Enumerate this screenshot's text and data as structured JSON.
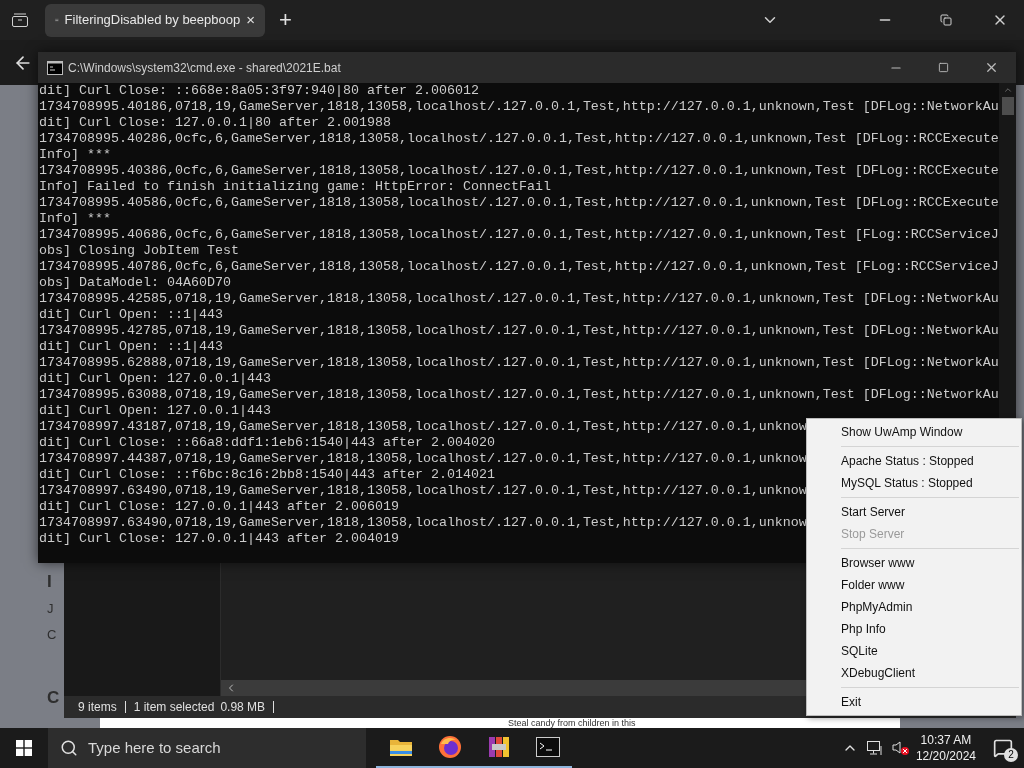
{
  "browser": {
    "tab": {
      "title": "FilteringDisabled by beepboop",
      "close": "×",
      "selected": true
    },
    "new_tab": "+"
  },
  "page": {
    "fragments": [
      {
        "kind": "heading",
        "text": "I"
      },
      {
        "kind": "line",
        "text": "J"
      },
      {
        "kind": "line",
        "text": "C"
      },
      {
        "kind": "heading",
        "text": "C"
      }
    ],
    "footer_text": "Steal candy from children in this"
  },
  "console": {
    "title": "C:\\Windows\\system32\\cmd.exe - shared\\2021E.bat",
    "lines": [
      "dit] Curl Close: ::668e:8a05:3f97:940|80 after 2.006012",
      "1734708995.40186,0718,19,GameServer,1818,13058,localhost/.127.0.0.1,Test,http://127.0.0.1,unknown,Test [DFLog::NetworkAu",
      "dit] Curl Close: 127.0.0.1|80 after 2.001988",
      "1734708995.40286,0cfc,6,GameServer,1818,13058,localhost/.127.0.0.1,Test,http://127.0.0.1,unknown,Test [DFLog::RCCExecute",
      "Info] ***",
      "1734708995.40386,0cfc,6,GameServer,1818,13058,localhost/.127.0.0.1,Test,http://127.0.0.1,unknown,Test [DFLog::RCCExecute",
      "Info] Failed to finish initializing game: HttpError: ConnectFail",
      "1734708995.40586,0cfc,6,GameServer,1818,13058,localhost/.127.0.0.1,Test,http://127.0.0.1,unknown,Test [DFLog::RCCExecute",
      "Info] ***",
      "1734708995.40686,0cfc,6,GameServer,1818,13058,localhost/.127.0.0.1,Test,http://127.0.0.1,unknown,Test [FLog::RCCServiceJ",
      "obs] Closing JobItem Test",
      "1734708995.40786,0cfc,6,GameServer,1818,13058,localhost/.127.0.0.1,Test,http://127.0.0.1,unknown,Test [FLog::RCCServiceJ",
      "obs] DataModel: 04A60D70",
      "1734708995.42585,0718,19,GameServer,1818,13058,localhost/.127.0.0.1,Test,http://127.0.0.1,unknown,Test [DFLog::NetworkAu",
      "dit] Curl Open: ::1|443",
      "1734708995.42785,0718,19,GameServer,1818,13058,localhost/.127.0.0.1,Test,http://127.0.0.1,unknown,Test [DFLog::NetworkAu",
      "dit] Curl Open: ::1|443",
      "1734708995.62888,0718,19,GameServer,1818,13058,localhost/.127.0.0.1,Test,http://127.0.0.1,unknown,Test [DFLog::NetworkAu",
      "dit] Curl Open: 127.0.0.1|443",
      "1734708995.63088,0718,19,GameServer,1818,13058,localhost/.127.0.0.1,Test,http://127.0.0.1,unknown,Test [DFLog::NetworkAu",
      "dit] Curl Open: 127.0.0.1|443",
      "1734708997.43187,0718,19,GameServer,1818,13058,localhost/.127.0.0.1,Test,http://127.0.0.1,unknow",
      "dit] Curl Close: ::66a8:ddf1:1eb6:1540|443 after 2.004020",
      "1734708997.44387,0718,19,GameServer,1818,13058,localhost/.127.0.0.1,Test,http://127.0.0.1,unknow",
      "dit] Curl Close: ::f6bc:8c16:2bb8:1540|443 after 2.014021",
      "1734708997.63490,0718,19,GameServer,1818,13058,localhost/.127.0.0.1,Test,http://127.0.0.1,unknow",
      "dit] Curl Close: 127.0.0.1|443 after 2.006019",
      "1734708997.63490,0718,19,GameServer,1818,13058,localhost/.127.0.0.1,Test,http://127.0.0.1,unknow",
      "dit] Curl Close: 127.0.0.1|443 after 2.004019"
    ]
  },
  "explorer": {
    "status": {
      "items": "9 items",
      "selected": "1 item selected",
      "size": "0.98 MB"
    }
  },
  "tray_menu": {
    "items": [
      {
        "kind": "item",
        "label": "Show UwAmp Window",
        "disabled": false
      },
      {
        "kind": "separator"
      },
      {
        "kind": "item",
        "label": "Apache Status : Stopped",
        "disabled": false
      },
      {
        "kind": "item",
        "label": "MySQL Status : Stopped",
        "disabled": false
      },
      {
        "kind": "separator"
      },
      {
        "kind": "item",
        "label": "Start Server",
        "disabled": false
      },
      {
        "kind": "item",
        "label": "Stop Server",
        "disabled": true
      },
      {
        "kind": "separator"
      },
      {
        "kind": "item",
        "label": "Browser www",
        "disabled": false
      },
      {
        "kind": "item",
        "label": "Folder www",
        "disabled": false
      },
      {
        "kind": "item",
        "label": "PhpMyAdmin",
        "disabled": false
      },
      {
        "kind": "item",
        "label": "Php Info",
        "disabled": false
      },
      {
        "kind": "item",
        "label": "SQLite",
        "disabled": false
      },
      {
        "kind": "item",
        "label": "XDebugClient",
        "disabled": false
      },
      {
        "kind": "separator"
      },
      {
        "kind": "item",
        "label": "Exit",
        "disabled": false
      }
    ]
  },
  "taskbar": {
    "search_placeholder": "Type here to search",
    "apps": [
      {
        "kind": "folder",
        "running": true
      },
      {
        "kind": "firefox",
        "running": true
      },
      {
        "kind": "archive",
        "running": true
      },
      {
        "kind": "terminal",
        "running": true
      }
    ],
    "time": "10:37 AM",
    "date": "12/20/2024",
    "notifications": "2"
  }
}
